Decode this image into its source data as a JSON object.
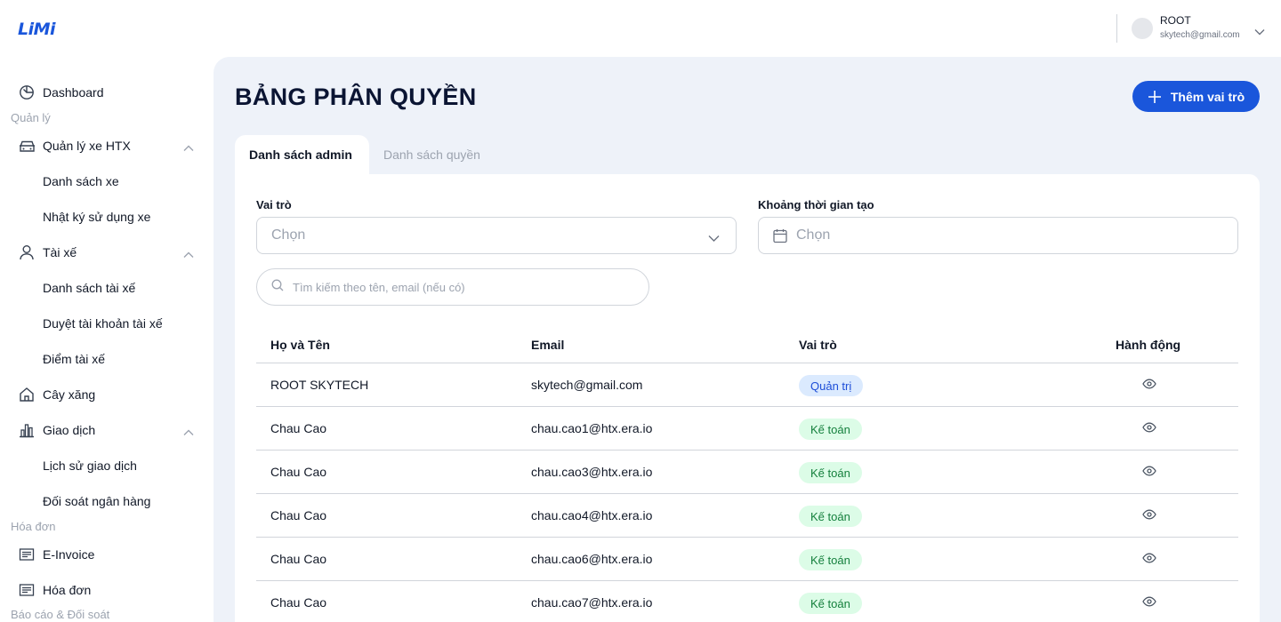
{
  "app": {
    "logo": "LiMi"
  },
  "user": {
    "name": "ROOT",
    "email": "skytech@gmail.com"
  },
  "sidebar": {
    "dashboard": "Dashboard",
    "section_manage": "Quản lý",
    "vehicles": "Quản lý xe HTX",
    "vehicle_list": "Danh sách xe",
    "vehicle_log": "Nhật ký sử dụng xe",
    "drivers": "Tài xế",
    "driver_list": "Danh sách tài xế",
    "driver_approve": "Duyệt tài khoản tài xế",
    "driver_points": "Điểm tài xế",
    "gas": "Cây xăng",
    "transactions": "Giao dịch",
    "tx_history": "Lịch sử giao dịch",
    "bank_recon": "Đối soát ngân hàng",
    "section_invoice": "Hóa đơn",
    "einvoice": "E-Invoice",
    "invoice": "Hóa đơn",
    "section_report": "Báo cáo & Đối soát"
  },
  "page": {
    "title": "BẢNG PHÂN QUYỀN",
    "add_button": "Thêm vai trò"
  },
  "tabs": {
    "admin_list": "Danh sách admin",
    "permission_list": "Danh sách quyền"
  },
  "filters": {
    "role_label": "Vai trò",
    "role_placeholder": "Chọn",
    "date_label": "Khoảng thời gian tạo",
    "date_placeholder": "Chọn",
    "search_placeholder": "Tìm kiếm theo tên, email (nếu có)"
  },
  "table": {
    "headers": {
      "name": "Họ và Tên",
      "email": "Email",
      "role": "Vai trò",
      "action": "Hành động"
    },
    "rows": [
      {
        "name": "ROOT SKYTECH",
        "email": "skytech@gmail.com",
        "role": "Quản trị"
      },
      {
        "name": "Chau Cao",
        "email": "chau.cao1@htx.era.io",
        "role": "Kế toán"
      },
      {
        "name": "Chau Cao",
        "email": "chau.cao3@htx.era.io",
        "role": "Kế toán"
      },
      {
        "name": "Chau Cao",
        "email": "chau.cao4@htx.era.io",
        "role": "Kế toán"
      },
      {
        "name": "Chau Cao",
        "email": "chau.cao6@htx.era.io",
        "role": "Kế toán"
      },
      {
        "name": "Chau Cao",
        "email": "chau.cao7@htx.era.io",
        "role": "Kế toán"
      }
    ]
  },
  "colors": {
    "primary": "#1a56db",
    "admin_badge_bg": "#dbeafe",
    "accountant_badge_bg": "#dcfce7",
    "main_bg": "#eef2f9"
  }
}
